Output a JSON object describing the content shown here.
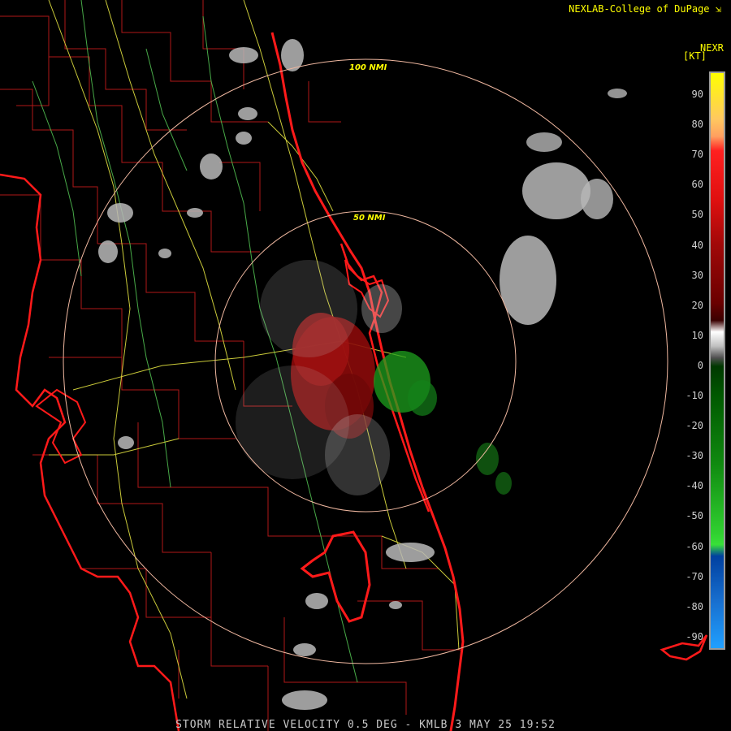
{
  "header": {
    "credit": "NEXLAB-College of DuPage"
  },
  "footer": {
    "product": "STORM RELATIVE VELOCITY 0.5 DEG - KMLB 3 MAY 25 19:52"
  },
  "legend": {
    "title": "NEXR",
    "units": "[KT]",
    "ticks": [
      "90",
      "80",
      "70",
      "60",
      "50",
      "40",
      "30",
      "20",
      "10",
      "0",
      "-10",
      "-20",
      "-30",
      "-40",
      "-50",
      "-60",
      "-70",
      "-80",
      "-90"
    ]
  },
  "range_rings": {
    "inner": "50 NMI",
    "outer": "100 NMI"
  },
  "colors": {
    "coastline": "#ff1a1a",
    "county_lines": "#b01818",
    "roads": "#e0e040",
    "rivers": "#55c855",
    "range_rings": "#f0b8a0",
    "inbound": "#1ea01e",
    "outbound": "#8b0a0a",
    "rf_gray": "#c0c0c0"
  }
}
